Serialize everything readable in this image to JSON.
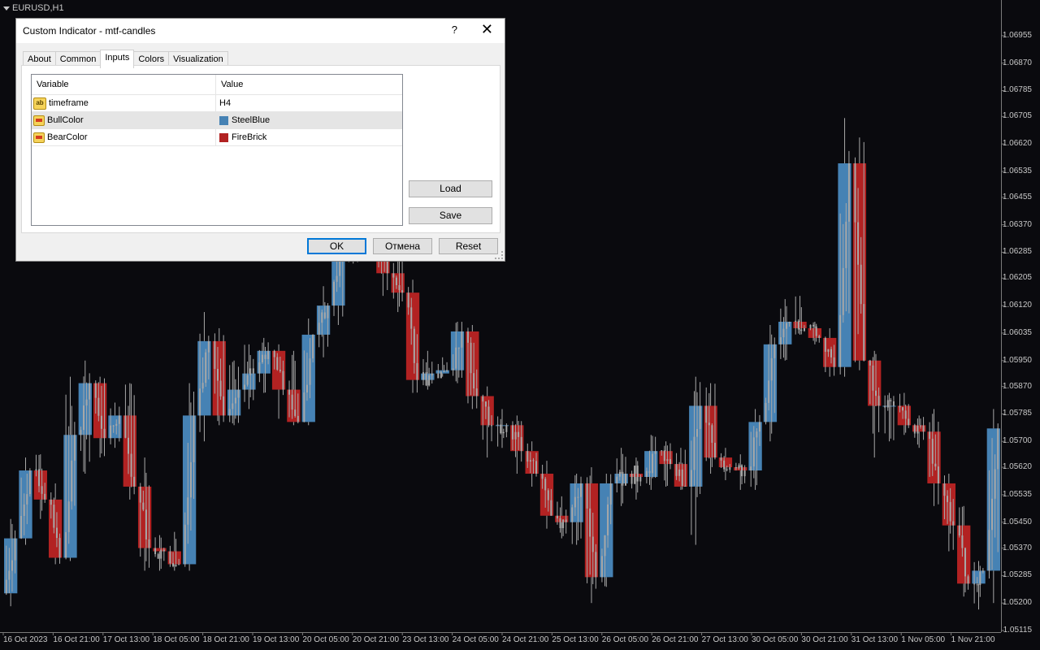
{
  "chart": {
    "symbol": "EURUSD,H1",
    "colors": {
      "background": "#0a0a0e",
      "bull": "#4682b4",
      "bear": "#b22222",
      "wick": "#a8a8a8",
      "text": "#c8c8c8"
    },
    "price_ticks": [
      "1.06955",
      "1.06870",
      "1.06785",
      "1.06705",
      "1.06620",
      "1.06535",
      "1.06455",
      "1.06370",
      "1.06285",
      "1.06205",
      "1.06120",
      "1.06035",
      "1.05950",
      "1.05870",
      "1.05785",
      "1.05700",
      "1.05620",
      "1.05535",
      "1.05450",
      "1.05370",
      "1.05285",
      "1.05200",
      "1.05115"
    ],
    "time_ticks": [
      "16 Oct 2023",
      "16 Oct 21:00",
      "17 Oct 13:00",
      "18 Oct 05:00",
      "18 Oct 21:00",
      "19 Oct 13:00",
      "20 Oct 05:00",
      "20 Oct 21:00",
      "23 Oct 13:00",
      "24 Oct 05:00",
      "24 Oct 21:00",
      "25 Oct 13:00",
      "26 Oct 05:00",
      "26 Oct 21:00",
      "27 Oct 13:00",
      "30 Oct 05:00",
      "30 Oct 21:00",
      "31 Oct 13:00",
      "1 Nov 05:00",
      "1 Nov 21:00"
    ]
  },
  "chart_data": {
    "type": "candlestick",
    "title": "EURUSD,H1",
    "ylim": [
      1.0511,
      1.0703
    ],
    "x_label_step": 8,
    "y_ticks": [
      1.06955,
      1.0687,
      1.06785,
      1.06705,
      1.0662,
      1.06535,
      1.06455,
      1.0637,
      1.06285,
      1.06205,
      1.0612,
      1.06035,
      1.0595,
      1.0587,
      1.05785,
      1.057,
      1.0562,
      1.05535,
      1.0545,
      1.0537,
      1.05285,
      1.052,
      1.05115
    ],
    "htf_candles_h4": [
      {
        "o": 1.0523,
        "c": 1.054,
        "h": 1.0546,
        "l": 1.0519
      },
      {
        "o": 1.054,
        "c": 1.0561,
        "h": 1.0565,
        "l": 1.0538
      },
      {
        "o": 1.0561,
        "c": 1.0552,
        "h": 1.0566,
        "l": 1.0546
      },
      {
        "o": 1.0552,
        "c": 1.0534,
        "h": 1.0557,
        "l": 1.0532
      },
      {
        "o": 1.0534,
        "c": 1.0572,
        "h": 1.059,
        "l": 1.0533
      },
      {
        "o": 1.0572,
        "c": 1.0588,
        "h": 1.0595,
        "l": 1.056
      },
      {
        "o": 1.0588,
        "c": 1.0571,
        "h": 1.059,
        "l": 1.0565
      },
      {
        "o": 1.0571,
        "c": 1.0578,
        "h": 1.0582,
        "l": 1.0568
      },
      {
        "o": 1.0578,
        "c": 1.0556,
        "h": 1.0588,
        "l": 1.0552
      },
      {
        "o": 1.0556,
        "c": 1.0537,
        "h": 1.0565,
        "l": 1.053
      },
      {
        "o": 1.0537,
        "c": 1.0536,
        "h": 1.0541,
        "l": 1.053
      },
      {
        "o": 1.0536,
        "c": 1.0532,
        "h": 1.0542,
        "l": 1.053
      },
      {
        "o": 1.0532,
        "c": 1.0578,
        "h": 1.0588,
        "l": 1.053
      },
      {
        "o": 1.0578,
        "c": 1.0601,
        "h": 1.061,
        "l": 1.057
      },
      {
        "o": 1.0601,
        "c": 1.0578,
        "h": 1.0605,
        "l": 1.0575
      },
      {
        "o": 1.0578,
        "c": 1.0586,
        "h": 1.0595,
        "l": 1.0575
      },
      {
        "o": 1.0586,
        "c": 1.0591,
        "h": 1.06,
        "l": 1.058
      },
      {
        "o": 1.0591,
        "c": 1.0598,
        "h": 1.0602,
        "l": 1.0585
      },
      {
        "o": 1.0598,
        "c": 1.0586,
        "h": 1.06,
        "l": 1.0577
      },
      {
        "o": 1.0586,
        "c": 1.0576,
        "h": 1.0598,
        "l": 1.0575
      },
      {
        "o": 1.0576,
        "c": 1.0603,
        "h": 1.0608,
        "l": 1.0575
      },
      {
        "o": 1.0603,
        "c": 1.0612,
        "h": 1.0618,
        "l": 1.0596
      },
      {
        "o": 1.0612,
        "c": 1.0633,
        "h": 1.064,
        "l": 1.0606
      },
      {
        "o": 1.0633,
        "c": 1.064,
        "h": 1.0645,
        "l": 1.0625
      },
      {
        "o": 1.064,
        "c": 1.0641,
        "h": 1.0648,
        "l": 1.063
      },
      {
        "o": 1.0641,
        "c": 1.0622,
        "h": 1.0645,
        "l": 1.0615
      },
      {
        "o": 1.0622,
        "c": 1.0616,
        "h": 1.0628,
        "l": 1.061
      },
      {
        "o": 1.0616,
        "c": 1.0589,
        "h": 1.062,
        "l": 1.0585
      },
      {
        "o": 1.0589,
        "c": 1.0591,
        "h": 1.0598,
        "l": 1.0586
      },
      {
        "o": 1.0591,
        "c": 1.0592,
        "h": 1.0596,
        "l": 1.059
      },
      {
        "o": 1.0592,
        "c": 1.0604,
        "h": 1.0607,
        "l": 1.0588
      },
      {
        "o": 1.0604,
        "c": 1.0584,
        "h": 1.0606,
        "l": 1.058
      },
      {
        "o": 1.0584,
        "c": 1.0575,
        "h": 1.0587,
        "l": 1.0565
      },
      {
        "o": 1.0575,
        "c": 1.0575,
        "h": 1.058,
        "l": 1.0568
      },
      {
        "o": 1.0575,
        "c": 1.0567,
        "h": 1.0578,
        "l": 1.056
      },
      {
        "o": 1.0567,
        "c": 1.056,
        "h": 1.057,
        "l": 1.0556
      },
      {
        "o": 1.056,
        "c": 1.0547,
        "h": 1.0564,
        "l": 1.0543
      },
      {
        "o": 1.0547,
        "c": 1.0545,
        "h": 1.0553,
        "l": 1.054
      },
      {
        "o": 1.0545,
        "c": 1.0557,
        "h": 1.056,
        "l": 1.0538
      },
      {
        "o": 1.0557,
        "c": 1.0528,
        "h": 1.0562,
        "l": 1.052
      },
      {
        "o": 1.0528,
        "c": 1.0557,
        "h": 1.056,
        "l": 1.0525
      },
      {
        "o": 1.0557,
        "c": 1.056,
        "h": 1.0568,
        "l": 1.055
      },
      {
        "o": 1.056,
        "c": 1.0559,
        "h": 1.0565,
        "l": 1.0552
      },
      {
        "o": 1.0559,
        "c": 1.0567,
        "h": 1.0572,
        "l": 1.0555
      },
      {
        "o": 1.0567,
        "c": 1.0563,
        "h": 1.057,
        "l": 1.0556
      },
      {
        "o": 1.0563,
        "c": 1.0556,
        "h": 1.0568,
        "l": 1.0555
      },
      {
        "o": 1.0556,
        "c": 1.0581,
        "h": 1.059,
        "l": 1.0538
      },
      {
        "o": 1.0581,
        "c": 1.0565,
        "h": 1.0588,
        "l": 1.056
      },
      {
        "o": 1.0565,
        "c": 1.0562,
        "h": 1.0568,
        "l": 1.0558
      },
      {
        "o": 1.0562,
        "c": 1.0561,
        "h": 1.0566,
        "l": 1.0555
      },
      {
        "o": 1.0561,
        "c": 1.0576,
        "h": 1.058,
        "l": 1.0555
      },
      {
        "o": 1.0576,
        "c": 1.06,
        "h": 1.0606,
        "l": 1.057
      },
      {
        "o": 1.06,
        "c": 1.0607,
        "h": 1.0614,
        "l": 1.0595
      },
      {
        "o": 1.0607,
        "c": 1.0605,
        "h": 1.0615,
        "l": 1.0603
      },
      {
        "o": 1.0605,
        "c": 1.0602,
        "h": 1.0607,
        "l": 1.06
      },
      {
        "o": 1.0602,
        "c": 1.0593,
        "h": 1.0605,
        "l": 1.059
      },
      {
        "o": 1.0593,
        "c": 1.0656,
        "h": 1.067,
        "l": 1.059
      },
      {
        "o": 1.0656,
        "c": 1.0595,
        "h": 1.0664,
        "l": 1.0592
      },
      {
        "o": 1.0595,
        "c": 1.0581,
        "h": 1.0598,
        "l": 1.0565
      },
      {
        "o": 1.0581,
        "c": 1.0581,
        "h": 1.0585,
        "l": 1.057
      },
      {
        "o": 1.0581,
        "c": 1.0575,
        "h": 1.0585,
        "l": 1.0572
      },
      {
        "o": 1.0575,
        "c": 1.0573,
        "h": 1.0578,
        "l": 1.0568
      },
      {
        "o": 1.0573,
        "c": 1.0557,
        "h": 1.058,
        "l": 1.055
      },
      {
        "o": 1.0557,
        "c": 1.0544,
        "h": 1.056,
        "l": 1.0536
      },
      {
        "o": 1.0544,
        "c": 1.0526,
        "h": 1.055,
        "l": 1.0522
      },
      {
        "o": 1.0526,
        "c": 1.053,
        "h": 1.0533,
        "l": 1.0518
      },
      {
        "o": 1.053,
        "c": 1.0574,
        "h": 1.058,
        "l": 1.052
      }
    ]
  },
  "dialog": {
    "title": "Custom Indicator - mtf-candles",
    "help_label": "?",
    "close_label": "✕",
    "tabs": [
      "About",
      "Common",
      "Inputs",
      "Colors",
      "Visualization"
    ],
    "active_tab": "Inputs",
    "columns": {
      "variable": "Variable",
      "value": "Value"
    },
    "rows": [
      {
        "icon": "ab",
        "icon_name": "string-param-icon",
        "variable": "timeframe",
        "value": "H4",
        "swatch": ""
      },
      {
        "icon": "color",
        "icon_name": "color-param-icon",
        "variable": "BullColor",
        "value": "SteelBlue",
        "swatch": "#4682b4"
      },
      {
        "icon": "color",
        "icon_name": "color-param-icon",
        "variable": "BearColor",
        "value": "FireBrick",
        "swatch": "#b22222"
      }
    ],
    "selected_row": 1,
    "buttons": {
      "load": "Load",
      "save": "Save",
      "ok": "OK",
      "cancel": "Отмена",
      "reset": "Reset"
    }
  }
}
